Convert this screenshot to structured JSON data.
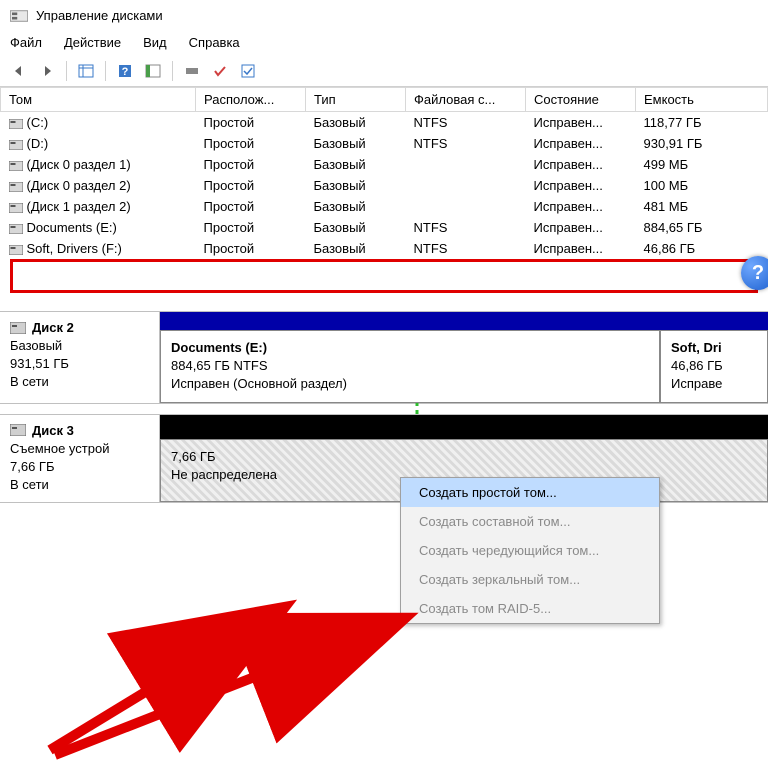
{
  "titlebar": {
    "title": "Управление дисками"
  },
  "menu": {
    "file": "Файл",
    "action": "Действие",
    "view": "Вид",
    "help": "Справка"
  },
  "table": {
    "headers": {
      "volume": "Том",
      "layout": "Располож...",
      "type": "Тип",
      "fs": "Файловая с...",
      "status": "Состояние",
      "capacity": "Емкость"
    },
    "rows": [
      {
        "name": "(C:)",
        "layout": "Простой",
        "type": "Базовый",
        "fs": "NTFS",
        "status": "Исправен...",
        "capacity": "118,77 ГБ"
      },
      {
        "name": "(D:)",
        "layout": "Простой",
        "type": "Базовый",
        "fs": "NTFS",
        "status": "Исправен...",
        "capacity": "930,91 ГБ"
      },
      {
        "name": "(Диск 0 раздел 1)",
        "layout": "Простой",
        "type": "Базовый",
        "fs": "",
        "status": "Исправен...",
        "capacity": "499 МБ"
      },
      {
        "name": "(Диск 0 раздел 2)",
        "layout": "Простой",
        "type": "Базовый",
        "fs": "",
        "status": "Исправен...",
        "capacity": "100 МБ"
      },
      {
        "name": "(Диск 1 раздел 2)",
        "layout": "Простой",
        "type": "Базовый",
        "fs": "",
        "status": "Исправен...",
        "capacity": "481 МБ"
      },
      {
        "name": "Documents (E:)",
        "layout": "Простой",
        "type": "Базовый",
        "fs": "NTFS",
        "status": "Исправен...",
        "capacity": "884,65 ГБ"
      },
      {
        "name": "Soft, Drivers (F:)",
        "layout": "Простой",
        "type": "Базовый",
        "fs": "NTFS",
        "status": "Исправен...",
        "capacity": "46,86 ГБ"
      }
    ]
  },
  "help_badge": "?",
  "disks": {
    "disk2": {
      "name": "Диск 2",
      "type": "Базовый",
      "size": "931,51 ГБ",
      "status": "В сети",
      "parts": [
        {
          "title": "Documents  (E:)",
          "line2": "884,65 ГБ NTFS",
          "line3": "Исправен (Основной раздел)"
        },
        {
          "title": "Soft, Dri",
          "line2": "46,86 ГБ",
          "line3": "Исправе"
        }
      ]
    },
    "disk3": {
      "name": "Диск 3",
      "type": "Съемное устрой",
      "size": "7,66 ГБ",
      "status": "В сети",
      "parts": [
        {
          "title": "",
          "line2": "7,66 ГБ",
          "line3": "Не распределена"
        }
      ]
    }
  },
  "context_menu": {
    "items": [
      {
        "label": "Создать простой том...",
        "enabled": true,
        "active": true
      },
      {
        "label": "Создать составной том...",
        "enabled": false
      },
      {
        "label": "Создать чередующийся том...",
        "enabled": false
      },
      {
        "label": "Создать зеркальный том...",
        "enabled": false
      },
      {
        "label": "Создать том RAID-5...",
        "enabled": false
      }
    ]
  }
}
